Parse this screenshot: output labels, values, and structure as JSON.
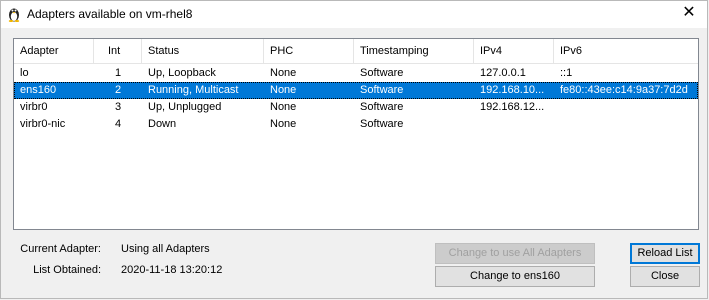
{
  "window": {
    "title": "Adapters available on vm-rhel8",
    "close_glyph": "✕",
    "icon": "linux-penguin-icon"
  },
  "table": {
    "columns": [
      "Adapter",
      "Int",
      "Status",
      "PHC",
      "Timestamping",
      "IPv4",
      "IPv6"
    ],
    "rows": [
      [
        "lo",
        "1",
        "Up, Loopback",
        "None",
        "Software",
        "127.0.0.1",
        "::1"
      ],
      [
        "ens160",
        "2",
        "Running, Multicast",
        "None",
        "Software",
        "192.168.10...",
        "fe80::43ee:c14:9a37:7d2d"
      ],
      [
        "virbr0",
        "3",
        "Up, Unplugged",
        "None",
        "Software",
        "192.168.12...",
        ""
      ],
      [
        "virbr0-nic",
        "4",
        "Down",
        "None",
        "Software",
        "",
        ""
      ]
    ],
    "selected_row": 1,
    "selection_color": "#0078d7"
  },
  "info": {
    "current_adapter_label": "Current Adapter:",
    "current_adapter_value": "Using all Adapters",
    "list_obtained_label": "List Obtained:",
    "list_obtained_value": "2020-11-18 13:20:12"
  },
  "buttons": {
    "use_all": "Change to use All Adapters",
    "change_to": "Change to ens160",
    "reload": "Reload List",
    "close": "Close"
  }
}
